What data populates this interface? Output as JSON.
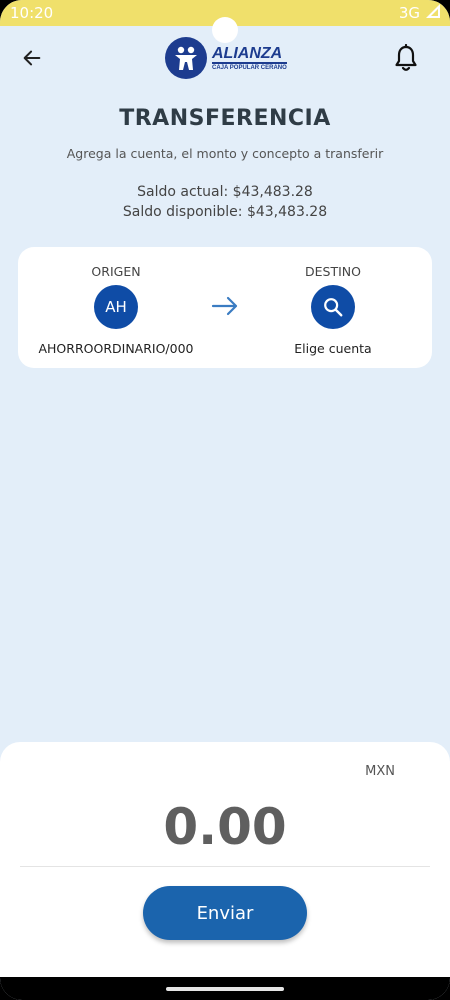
{
  "status_bar": {
    "time": "10:20",
    "network": "3G"
  },
  "header": {
    "brand_name": "ALIANZA",
    "brand_subtitle": "CAJA POPULAR CERANO"
  },
  "page": {
    "title": "TRANSFERENCIA",
    "subtitle": "Agrega la cuenta, el monto y concepto a transferir",
    "saldo_actual": "Saldo actual: $43,483.28",
    "saldo_disponible": "Saldo disponible: $43,483.28"
  },
  "transfer": {
    "origin": {
      "label": "ORIGEN",
      "avatar": "AH",
      "account": "AHORROORDINARIO/000"
    },
    "destination": {
      "label": "DESTINO",
      "action": "Elige cuenta"
    }
  },
  "amount": {
    "currency": "MXN",
    "value": "0.00"
  },
  "actions": {
    "send_label": "Enviar"
  },
  "colors": {
    "status_bar": "#f0e06b",
    "background": "#e3eef9",
    "primary": "#0f4ca6",
    "button": "#1b64ad",
    "brand": "#1d3c8f"
  },
  "icons": [
    "back-arrow",
    "bell",
    "arrow-right",
    "search",
    "signal"
  ]
}
